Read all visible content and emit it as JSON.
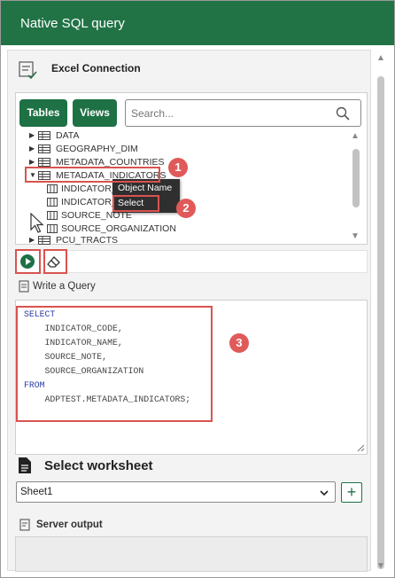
{
  "window": {
    "title": "Native SQL query"
  },
  "connection": {
    "label": "Excel Connection"
  },
  "browser": {
    "tables_button": "Tables",
    "views_button": "Views",
    "search_placeholder": "Search..."
  },
  "tree": {
    "tables": [
      {
        "label": "DATA",
        "expanded": false
      },
      {
        "label": "GEOGRAPHY_DIM",
        "expanded": false
      },
      {
        "label": "METADATA_COUNTRIES",
        "expanded": false
      },
      {
        "label": "METADATA_INDICATORS",
        "expanded": true
      }
    ],
    "columns": [
      {
        "label": "INDICATOR_"
      },
      {
        "label": "INDICATOR_"
      },
      {
        "label": "SOURCE_NOTE"
      },
      {
        "label": "SOURCE_ORGANIZATION"
      }
    ],
    "after": {
      "label": "PCU_TRACTS",
      "expanded": false
    }
  },
  "context_menu": {
    "items": [
      "Object Name",
      "Select"
    ]
  },
  "annotations": [
    "1",
    "2",
    "3"
  ],
  "query_section": {
    "label": "Write a Query",
    "code": [
      "SELECT",
      "    INDICATOR_CODE,",
      "    INDICATOR_NAME,",
      "    SOURCE_NOTE,",
      "    SOURCE_ORGANIZATION",
      "FROM",
      "    ADPTEST.METADATA_INDICATORS;"
    ]
  },
  "worksheet": {
    "label": "Select worksheet",
    "selected": "Sheet1",
    "add_label": "+"
  },
  "server_output": {
    "label": "Server output"
  },
  "colors": {
    "title_bar": "#217346",
    "button_green": "#1e7145",
    "annotation_red": "#d9534f",
    "keyword_blue": "#2b3aa7",
    "context_menu_bg": "#2f2f2f"
  }
}
